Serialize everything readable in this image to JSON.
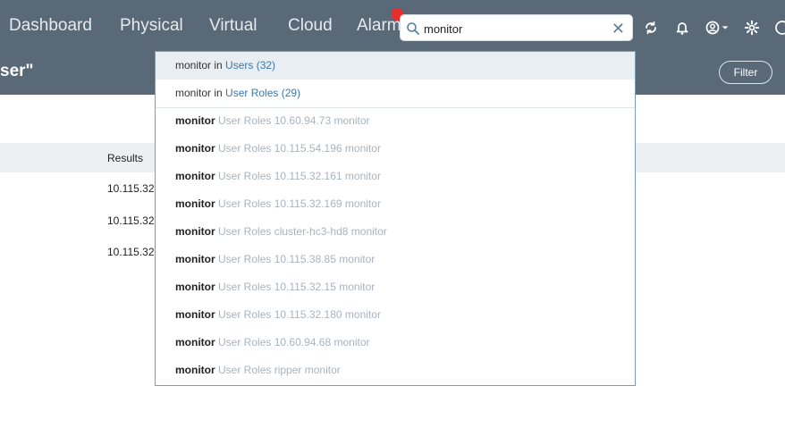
{
  "nav": {
    "items": [
      "Dashboard",
      "Physical",
      "Virtual",
      "Cloud",
      "Alarm"
    ]
  },
  "search": {
    "value": "monitor",
    "clear_glyph": "✕"
  },
  "toolbar": {
    "icons": [
      "refresh-icon",
      "bell-icon",
      "user-icon",
      "gear-icon",
      "help-icon"
    ]
  },
  "page": {
    "title": "ser\"",
    "filter_label": "Filter"
  },
  "results": {
    "header": "Results",
    "rows": [
      "10.115.32",
      "10.115.32",
      "10.115.32"
    ]
  },
  "dropdown": {
    "scopes": [
      {
        "term": "monitor",
        "in": "in",
        "target": "Users (32)"
      },
      {
        "term": "monitor",
        "in": "in",
        "target": "User Roles (29)"
      }
    ],
    "items": [
      {
        "term": "monitor",
        "type": "User Roles",
        "host": "10.60.94.73",
        "name": "monitor"
      },
      {
        "term": "monitor",
        "type": "User Roles",
        "host": "10.115.54.196",
        "name": "monitor"
      },
      {
        "term": "monitor",
        "type": "User Roles",
        "host": "10.115.32.161",
        "name": "monitor"
      },
      {
        "term": "monitor",
        "type": "User Roles",
        "host": "10.115.32.169",
        "name": "monitor"
      },
      {
        "term": "monitor",
        "type": "User Roles",
        "host": "cluster-hc3-hd8",
        "name": "monitor"
      },
      {
        "term": "monitor",
        "type": "User Roles",
        "host": "10.115.38.85",
        "name": "monitor"
      },
      {
        "term": "monitor",
        "type": "User Roles",
        "host": "10.115.32.15",
        "name": "monitor"
      },
      {
        "term": "monitor",
        "type": "User Roles",
        "host": "10.115.32.180",
        "name": "monitor"
      },
      {
        "term": "monitor",
        "type": "User Roles",
        "host": "10.60.94.68",
        "name": "monitor"
      },
      {
        "term": "monitor",
        "type": "User Roles",
        "host": "ripper",
        "name": "monitor"
      }
    ]
  },
  "colors": {
    "navbar": "#5a6978",
    "link": "#3d76a8",
    "badge": "#e52f2f"
  }
}
